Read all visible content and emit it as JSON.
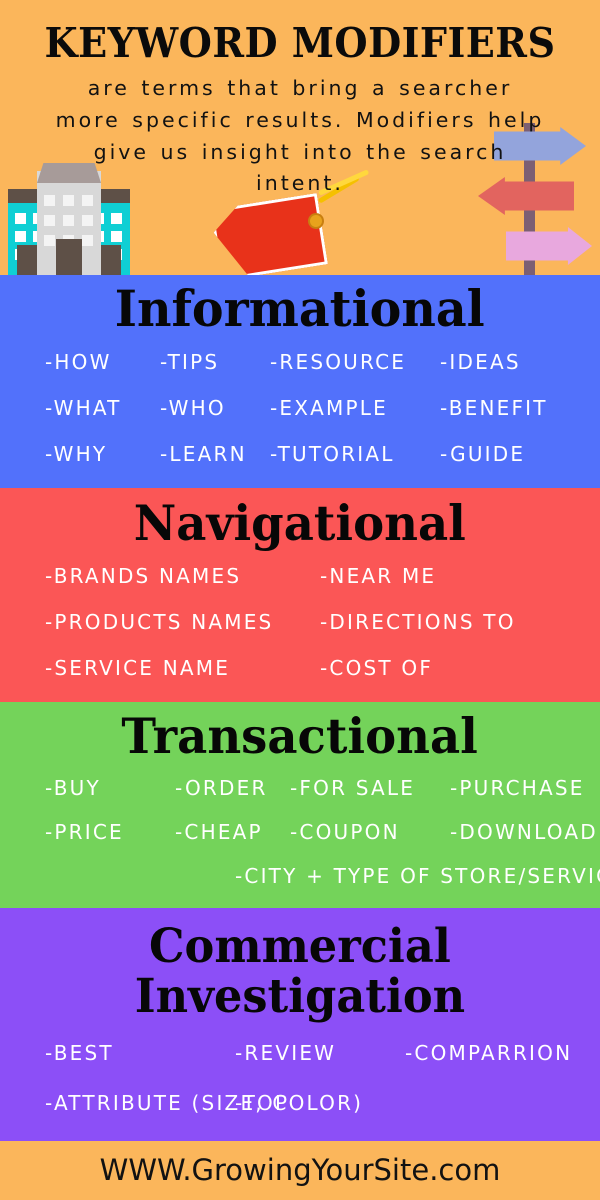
{
  "header": {
    "title": "KEYWORD MODIFIERS",
    "subtitle": "are terms that bring a searcher more specific results. Modifiers help give us insight into the search intent.",
    "background_color": "#FBB65B",
    "illustrations": [
      "building-illustration",
      "price-tag-illustration",
      "signpost-illustration"
    ]
  },
  "sections": [
    {
      "title": "Informational",
      "color": "#5271FB",
      "rows": [
        [
          "-HOW",
          "-TIPS",
          "-RESOURCE",
          "-IDEAS"
        ],
        [
          "-WHAT",
          "-WHO",
          "-EXAMPLE",
          "-BENEFIT"
        ],
        [
          "-WHY",
          "-LEARN",
          "-TUTORIAL",
          "-GUIDE"
        ]
      ]
    },
    {
      "title": "Navigational",
      "color": "#FB5656",
      "rows": [
        [
          "-BRANDS NAMES",
          "-NEAR ME"
        ],
        [
          "-PRODUCTS NAMES",
          "-DIRECTIONS TO"
        ],
        [
          "-SERVICE NAME",
          "-COST OF"
        ]
      ]
    },
    {
      "title": "Transactional",
      "color": "#74D35A",
      "rows": [
        [
          "-BUY",
          "-ORDER",
          "-FOR SALE",
          "-PURCHASE"
        ],
        [
          "-PRICE",
          "-CHEAP",
          "-COUPON",
          "-DOWNLOAD"
        ],
        [
          "-CITY + TYPE OF STORE/SERVICE"
        ]
      ]
    },
    {
      "title": "Commercial Investigation",
      "title_line1": "Commercial",
      "title_line2": "Investigation",
      "color": "#8C4FF7",
      "rows": [
        [
          "-BEST",
          "-REVIEW",
          "-COMPARRION"
        ],
        [
          "-ATTRIBUTE (SIZE, COLOR)",
          "-TOP"
        ]
      ]
    }
  ],
  "footer": {
    "url": "WWW.GrowingYourSite.com",
    "background_color": "#FBB65B"
  }
}
